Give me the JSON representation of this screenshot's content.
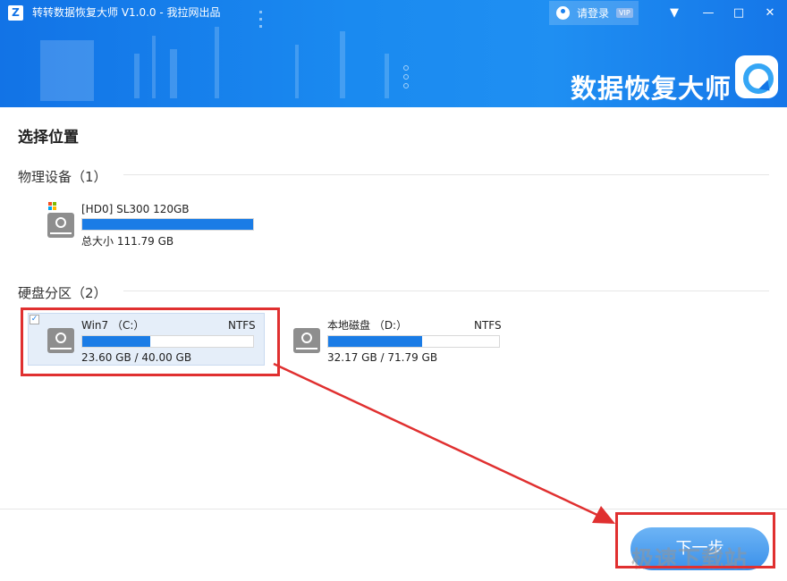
{
  "window": {
    "title": "转转数据恢复大师 V1.0.0 - 我拉网出品",
    "logo_letter": "Z",
    "login_label": "请登录",
    "vip_badge": "VIP",
    "brand_text": "数据恢复大师",
    "controls": {
      "menu": "▼",
      "minimize": "—",
      "maximize": "□",
      "close": "✕"
    }
  },
  "page": {
    "title": "选择位置",
    "next_button": "下一步",
    "watermark": "极速下载站"
  },
  "physical": {
    "heading": "物理设备（1）",
    "devices": [
      {
        "name": "[HD0] SL300 120GB",
        "total": "总大小 111.79 GB",
        "usage_percent": 100
      }
    ]
  },
  "partitions": {
    "heading": "硬盘分区（2）",
    "items": [
      {
        "name": "Win7 （C:）",
        "fs": "NTFS",
        "usage": "23.60 GB / 40.00 GB",
        "usage_percent": 40,
        "selected": true
      },
      {
        "name": "本地磁盘 （D:）",
        "fs": "NTFS",
        "usage": "32.17 GB / 71.79 GB",
        "usage_percent": 55,
        "selected": false
      }
    ]
  },
  "colors": {
    "accent": "#1a7ce6",
    "annotation": "#e03030",
    "banner": "#1a8af0"
  },
  "icons": [
    "app-logo-icon",
    "user-icon",
    "windows-flag-icon",
    "hard-disk-icon",
    "check-icon",
    "brand-logo-icon"
  ]
}
